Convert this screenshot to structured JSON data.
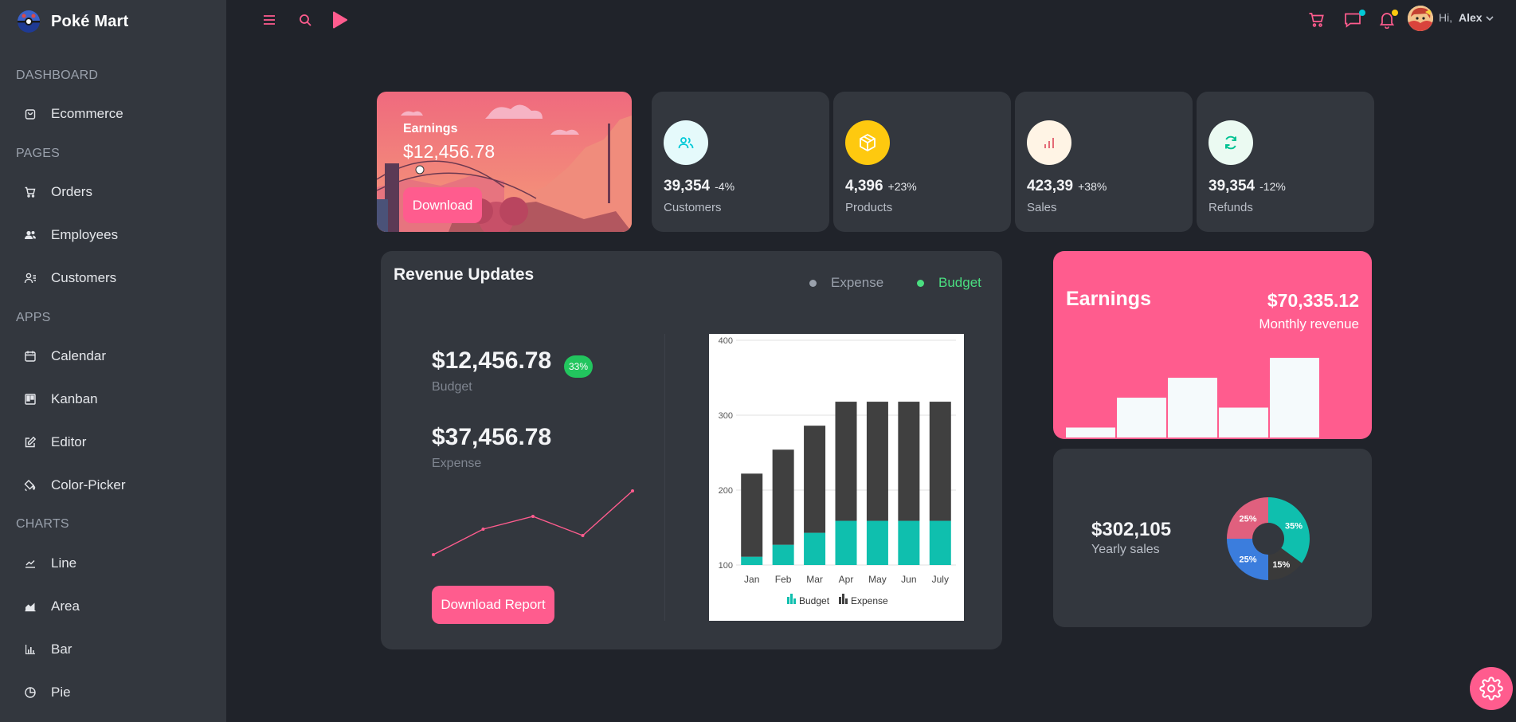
{
  "brand": {
    "name": "Poké Mart"
  },
  "sidebar": {
    "sections": [
      {
        "title": "DASHBOARD",
        "items": [
          {
            "label": "Ecommerce",
            "icon": "shopping-bag-icon"
          }
        ]
      },
      {
        "title": "PAGES",
        "items": [
          {
            "label": "Orders",
            "icon": "cart-icon"
          },
          {
            "label": "Employees",
            "icon": "users-icon"
          },
          {
            "label": "Customers",
            "icon": "contacts-icon"
          }
        ]
      },
      {
        "title": "APPS",
        "items": [
          {
            "label": "Calendar",
            "icon": "calendar-icon"
          },
          {
            "label": "Kanban",
            "icon": "kanban-icon"
          },
          {
            "label": "Editor",
            "icon": "edit-icon"
          },
          {
            "label": "Color-Picker",
            "icon": "paint-bucket-icon"
          }
        ]
      },
      {
        "title": "CHARTS",
        "items": [
          {
            "label": "Line",
            "icon": "line-chart-icon"
          },
          {
            "label": "Area",
            "icon": "area-chart-icon"
          },
          {
            "label": "Bar",
            "icon": "bar-chart-icon"
          },
          {
            "label": "Pie",
            "icon": "pie-chart-icon"
          }
        ]
      }
    ]
  },
  "topbar": {
    "greeting": "Hi,",
    "user": "Alex",
    "icons": [
      "menu-icon",
      "search-icon",
      "play-icon",
      "cart-icon",
      "chat-icon",
      "bell-icon",
      "avatar",
      "chevron-down-icon"
    ]
  },
  "hero": {
    "title": "Earnings",
    "amount": "$12,456.78",
    "button": "Download"
  },
  "stats": [
    {
      "value": "39,354",
      "change": "-4%",
      "label": "Customers",
      "icon": "users-icon",
      "icon_color": "#03c9d7",
      "icon_bg": "#e5fafb"
    },
    {
      "value": "4,396",
      "change": "+23%",
      "label": "Products",
      "icon": "box-icon",
      "icon_color": "#ffffff",
      "icon_bg": "#fec90f"
    },
    {
      "value": "423,39",
      "change": "+38%",
      "label": "Sales",
      "icon": "bar-chart-icon",
      "icon_color": "#e46a76",
      "icon_bg": "#fff4e5"
    },
    {
      "value": "39,354",
      "change": "-12%",
      "label": "Refunds",
      "icon": "refresh-icon",
      "icon_color": "#00c292",
      "icon_bg": "#ebfaf2"
    }
  ],
  "revenue": {
    "title": "Revenue Updates",
    "legend": [
      {
        "label": "Expense",
        "color": "#9aa1ac"
      },
      {
        "label": "Budget",
        "color": "#4ade80"
      }
    ],
    "budget_value": "$12,456.78",
    "budget_badge": "33%",
    "budget_label": "Budget",
    "expense_value": "$37,456.78",
    "expense_label": "Expense",
    "button": "Download Report"
  },
  "earnings_card": {
    "title": "Earnings",
    "value": "$70,335.12",
    "subtitle": "Monthly revenue",
    "color": "#ff5c8e"
  },
  "yearly": {
    "value": "$302,105",
    "label": "Yearly sales"
  },
  "colors": {
    "accent": "#ff5c8e",
    "budget": "#0fbfae",
    "expense": "#404040"
  },
  "chart_data": [
    {
      "type": "bar",
      "title": "",
      "stacked": true,
      "categories": [
        "Jan",
        "Feb",
        "Mar",
        "Apr",
        "May",
        "Jun",
        "July"
      ],
      "series": [
        {
          "name": "Budget",
          "color": "#0fbfae",
          "values": [
            111,
            127,
            143,
            159,
            159,
            159,
            159
          ]
        },
        {
          "name": "Expense",
          "color": "#404040",
          "values": [
            111,
            127,
            143,
            159,
            159,
            159,
            159
          ]
        }
      ],
      "ylim": [
        100,
        400
      ],
      "yticks": [
        "100",
        "200",
        "300",
        "400"
      ],
      "legend": "bottom"
    },
    {
      "type": "line",
      "series": [
        {
          "values": [
            1,
            3,
            4,
            2.5,
            6
          ]
        }
      ],
      "color": "#ff5c8e"
    },
    {
      "type": "bar",
      "series": [
        {
          "values": [
            1.5,
            6,
            9,
            4.5,
            12
          ]
        }
      ],
      "color": "#f5fafc"
    },
    {
      "type": "pie",
      "donut": true,
      "labels": [
        "35%",
        "15%",
        "25%",
        "25%"
      ],
      "values": [
        35,
        15,
        25,
        25
      ],
      "colors": [
        "#0fbfae",
        "#3a3a3a",
        "#3b7ddd",
        "#e0607e"
      ]
    }
  ]
}
